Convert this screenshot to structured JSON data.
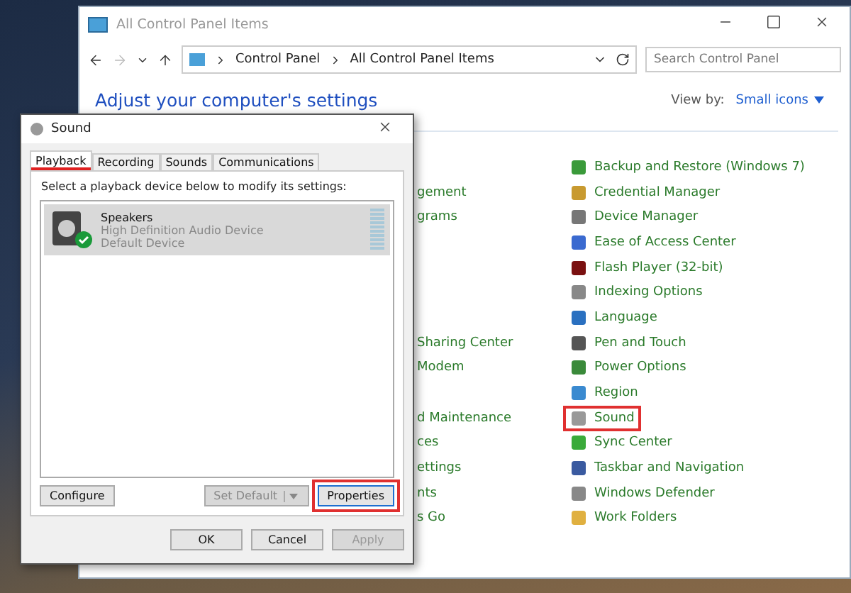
{
  "control_panel": {
    "title": "All Control Panel Items",
    "breadcrumb": [
      "Control Panel",
      "All Control Panel Items"
    ],
    "search": {
      "placeholder": "Search Control Panel"
    },
    "heading": "Adjust your computer's settings",
    "view_by": {
      "label": "View by:",
      "value": "Small icons"
    },
    "rows": [
      {
        "item": {
          "label": "Backup and Restore (Windows 7)",
          "highlighted": false
        }
      },
      {
        "left": "gement",
        "item": {
          "label": "Credential Manager",
          "highlighted": false
        }
      },
      {
        "left": "grams",
        "item": {
          "label": "Device Manager",
          "highlighted": false
        }
      },
      {
        "item": {
          "label": "Ease of Access Center",
          "highlighted": false
        }
      },
      {
        "item": {
          "label": "Flash Player (32-bit)",
          "highlighted": false
        }
      },
      {
        "item": {
          "label": "Indexing Options",
          "highlighted": false
        }
      },
      {
        "item": {
          "label": "Language",
          "highlighted": false
        }
      },
      {
        "left": "Sharing Center",
        "item": {
          "label": "Pen and Touch",
          "highlighted": false
        }
      },
      {
        "left": "Modem",
        "item": {
          "label": "Power Options",
          "highlighted": false
        }
      },
      {
        "item": {
          "label": "Region",
          "highlighted": false
        }
      },
      {
        "left": "d Maintenance",
        "item": {
          "label": "Sound",
          "highlighted": true
        }
      },
      {
        "left": "ces",
        "item": {
          "label": "Sync Center",
          "highlighted": false
        }
      },
      {
        "left": "ettings",
        "item": {
          "label": "Taskbar and Navigation",
          "highlighted": false
        }
      },
      {
        "left": "nts",
        "item": {
          "label": "Windows Defender",
          "highlighted": false
        }
      },
      {
        "left": "s Go",
        "item": {
          "label": "Work Folders",
          "highlighted": false
        }
      }
    ]
  },
  "dialog": {
    "title": "Sound",
    "tabs": [
      {
        "label": "Playback",
        "selected": true
      },
      {
        "label": "Recording",
        "selected": false
      },
      {
        "label": "Sounds",
        "selected": false
      },
      {
        "label": "Communications",
        "selected": false
      }
    ],
    "instruction": "Select a playback device below to modify its settings:",
    "devices": [
      {
        "name": "Speakers",
        "description": "High Definition Audio Device",
        "status": "Default Device",
        "selected": true,
        "is_default": true
      }
    ],
    "buttons": [
      {
        "label": "Configure",
        "kind": "plain",
        "disabled": false,
        "highlighted": false
      },
      {
        "label": "Set Default",
        "kind": "split",
        "disabled": true,
        "highlighted": false
      },
      {
        "label": "Properties",
        "kind": "plain",
        "disabled": false,
        "highlighted": true
      }
    ],
    "footer_buttons": [
      {
        "label": "OK",
        "disabled": false
      },
      {
        "label": "Cancel",
        "disabled": false
      },
      {
        "label": "Apply",
        "disabled": true
      }
    ]
  }
}
